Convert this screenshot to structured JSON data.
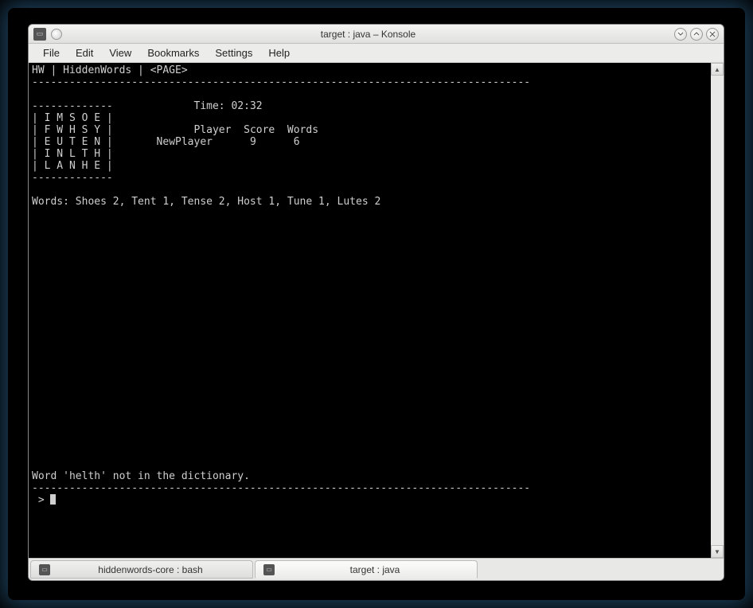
{
  "window": {
    "title": "target : java – Konsole"
  },
  "menubar": {
    "items": [
      "File",
      "Edit",
      "View",
      "Bookmarks",
      "Settings",
      "Help"
    ]
  },
  "terminal": {
    "header": "HW | HiddenWords | <PAGE>",
    "divider_top": "--------------------------------------------------------------------------------",
    "grid_top": "-------------",
    "grid_rows": [
      "| I M S O E |",
      "| F W H S Y |",
      "| E U T E N |",
      "| I N L T H |",
      "| L A N H E |"
    ],
    "grid_bottom": "-------------",
    "time_label": "Time: 02:32",
    "score_header": "Player  Score  Words",
    "score_row": "NewPlayer      9      6",
    "words_line": "Words: Shoes 2, Tent 1, Tense 2, Host 1, Tune 1, Lutes 2",
    "error_line": "Word 'helth' not in the dictionary.",
    "divider_bottom": "--------------------------------------------------------------------------------",
    "prompt": " > "
  },
  "tabs": {
    "items": [
      {
        "label": "hiddenwords-core : bash",
        "active": false
      },
      {
        "label": "target : java",
        "active": true
      }
    ]
  }
}
